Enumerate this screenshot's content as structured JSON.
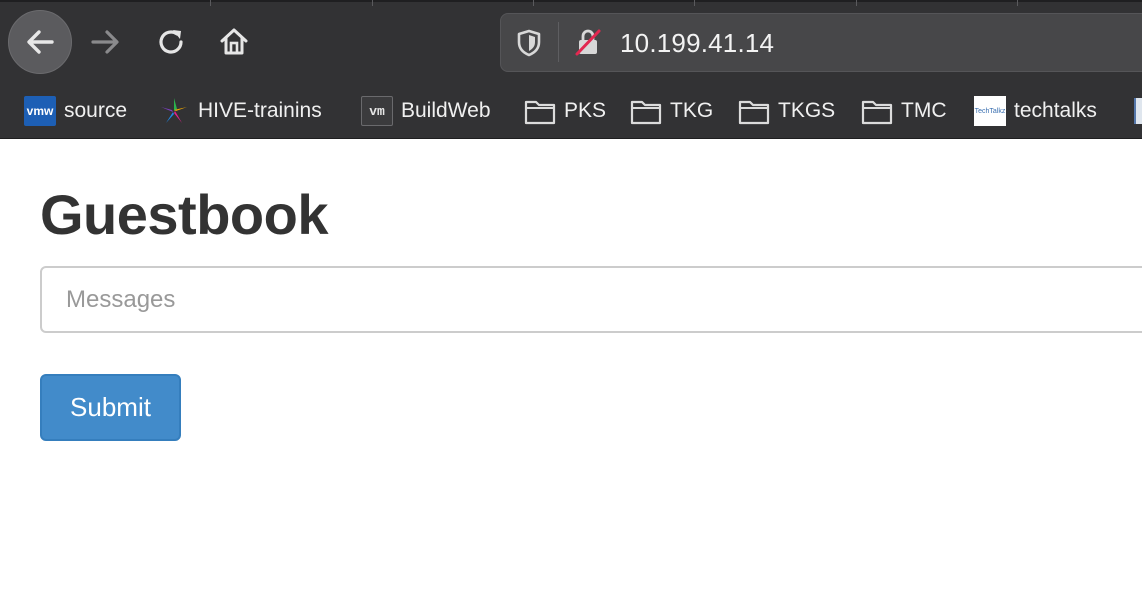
{
  "browser": {
    "url": "10.199.41.14",
    "bookmarks": [
      {
        "label": "source",
        "icon": "vmw-icon",
        "icon_text": "vmw"
      },
      {
        "label": "HIVE-trainins",
        "icon": "hive-icon"
      },
      {
        "label": "BuildWeb",
        "icon": "vm-icon",
        "icon_text": "vm"
      },
      {
        "label": "PKS",
        "icon": "folder-icon"
      },
      {
        "label": "TKG",
        "icon": "folder-icon"
      },
      {
        "label": "TKGS",
        "icon": "folder-icon"
      },
      {
        "label": "TMC",
        "icon": "folder-icon"
      },
      {
        "label": "techtalks",
        "icon": "techtalks-icon",
        "icon_text": "TechTalkz"
      }
    ]
  },
  "page": {
    "title": "Guestbook",
    "messages_placeholder": "Messages",
    "submit_label": "Submit"
  },
  "colors": {
    "chrome_bg": "#323234",
    "button_primary": "#428bca",
    "title_text": "#333333"
  }
}
